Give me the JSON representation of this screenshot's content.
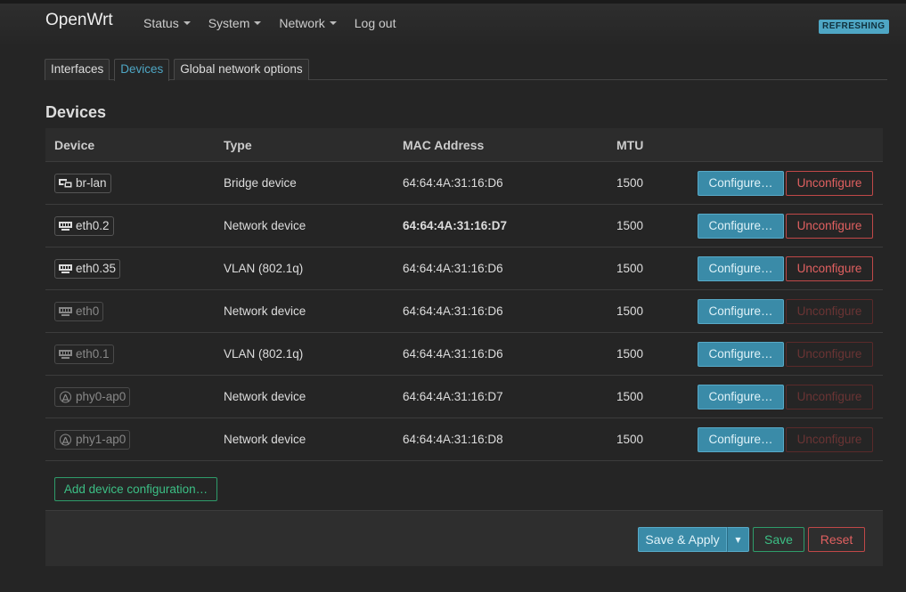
{
  "brand": "OpenWrt",
  "menu": [
    {
      "label": "Status",
      "dropdown": true
    },
    {
      "label": "System",
      "dropdown": true
    },
    {
      "label": "Network",
      "dropdown": true
    },
    {
      "label": "Log out",
      "dropdown": false
    }
  ],
  "status_badge": "REFRESHING",
  "tabs": [
    {
      "label": "Interfaces",
      "active": false
    },
    {
      "label": "Devices",
      "active": true
    },
    {
      "label": "Global network options",
      "active": false
    }
  ],
  "section_title": "Devices",
  "table": {
    "headers": [
      "Device",
      "Type",
      "MAC Address",
      "MTU"
    ],
    "rows": [
      {
        "device": "br-lan",
        "icon": "bridge-icon",
        "dim": false,
        "type": "Bridge device",
        "mac": "64:64:4A:31:16:D6",
        "mac_bold": false,
        "mtu": "1500",
        "configure": "Configure…",
        "unconfigure": "Unconfigure",
        "unconfigure_enabled": true
      },
      {
        "device": "eth0.2",
        "icon": "ethernet-icon",
        "dim": false,
        "type": "Network device",
        "mac": "64:64:4A:31:16:D7",
        "mac_bold": true,
        "mtu": "1500",
        "configure": "Configure…",
        "unconfigure": "Unconfigure",
        "unconfigure_enabled": true
      },
      {
        "device": "eth0.35",
        "icon": "ethernet-icon",
        "dim": false,
        "type": "VLAN (802.1q)",
        "mac": "64:64:4A:31:16:D6",
        "mac_bold": false,
        "mtu": "1500",
        "configure": "Configure…",
        "unconfigure": "Unconfigure",
        "unconfigure_enabled": true
      },
      {
        "device": "eth0",
        "icon": "ethernet-icon",
        "dim": true,
        "type": "Network device",
        "mac": "64:64:4A:31:16:D6",
        "mac_bold": false,
        "mtu": "1500",
        "configure": "Configure…",
        "unconfigure": "Unconfigure",
        "unconfigure_enabled": false
      },
      {
        "device": "eth0.1",
        "icon": "ethernet-icon",
        "dim": true,
        "type": "VLAN (802.1q)",
        "mac": "64:64:4A:31:16:D6",
        "mac_bold": false,
        "mtu": "1500",
        "configure": "Configure…",
        "unconfigure": "Unconfigure",
        "unconfigure_enabled": false
      },
      {
        "device": "phy0-ap0",
        "icon": "wifi-icon",
        "dim": true,
        "type": "Network device",
        "mac": "64:64:4A:31:16:D7",
        "mac_bold": false,
        "mtu": "1500",
        "configure": "Configure…",
        "unconfigure": "Unconfigure",
        "unconfigure_enabled": false
      },
      {
        "device": "phy1-ap0",
        "icon": "wifi-icon",
        "dim": true,
        "type": "Network device",
        "mac": "64:64:4A:31:16:D8",
        "mac_bold": false,
        "mtu": "1500",
        "configure": "Configure…",
        "unconfigure": "Unconfigure",
        "unconfigure_enabled": false
      }
    ]
  },
  "add_device_label": "Add device configuration…",
  "footer": {
    "save_apply": "Save & Apply",
    "dropdown_glyph": "▼",
    "save": "Save",
    "reset": "Reset"
  },
  "colors": {
    "accent": "#3a8ba8",
    "positive": "#3cbf85",
    "negative": "#e06060",
    "background": "#252525"
  }
}
